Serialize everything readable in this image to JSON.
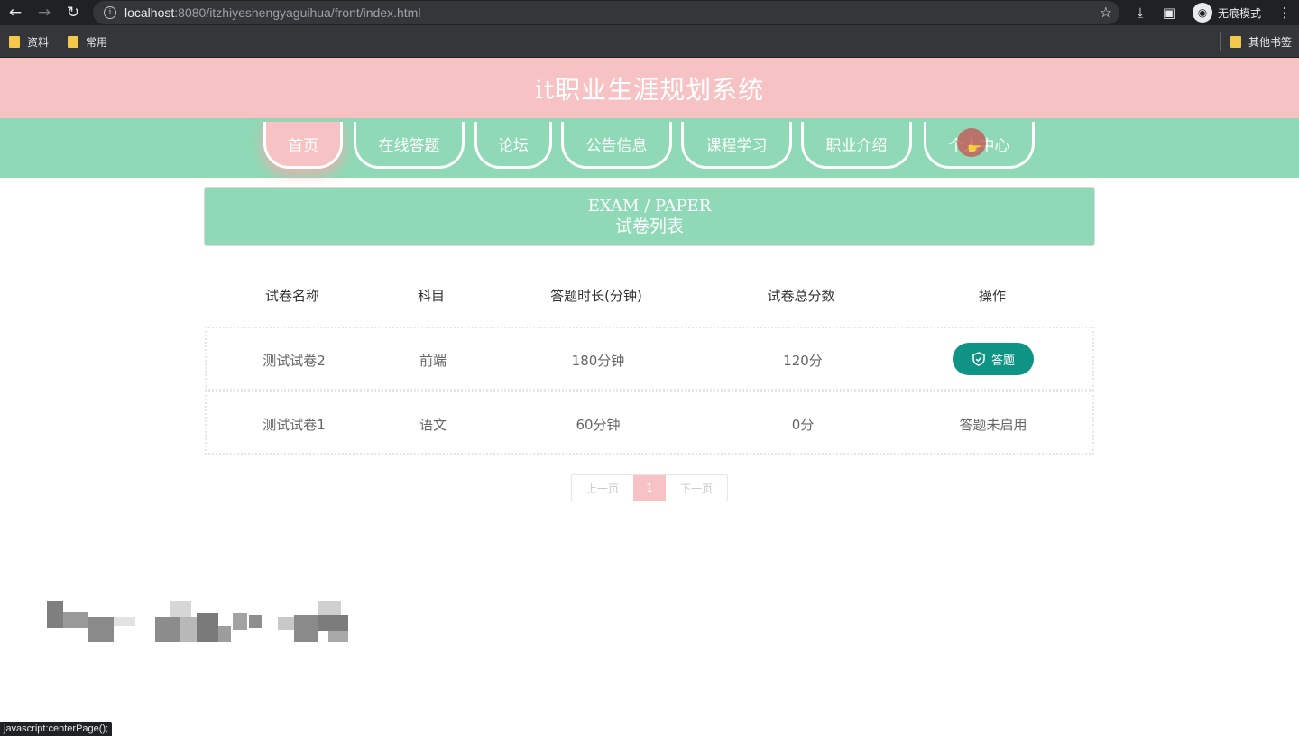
{
  "browser": {
    "url_host": "localhost",
    "url_rest": ":8080/itzhiyeshengyaguihua/front/index.html",
    "incognito_label": "无痕模式",
    "bookmarks": [
      "资料",
      "常用"
    ],
    "other_bookmarks": "其他书签",
    "status_text": "javascript:centerPage();"
  },
  "site": {
    "title": "it职业生涯规划系统",
    "nav": [
      "首页",
      "在线答题",
      "论坛",
      "公告信息",
      "课程学习",
      "职业介绍",
      "个人中心"
    ],
    "active_nav": "首页"
  },
  "section": {
    "title_en": "EXAM / PAPER",
    "title_cn": "试卷列表"
  },
  "table": {
    "headers": [
      "试卷名称",
      "科目",
      "答题时长(分钟)",
      "试卷总分数",
      "操作"
    ],
    "rows": [
      {
        "name": "测试试卷2",
        "subject": "前端",
        "duration": "180分钟",
        "score": "120分",
        "action": "答题",
        "action_type": "button"
      },
      {
        "name": "测试试卷1",
        "subject": "语文",
        "duration": "60分钟",
        "score": "0分",
        "action": "答题未启用",
        "action_type": "text"
      }
    ]
  },
  "pagination": {
    "prev": "上一页",
    "current": "1",
    "next": "下一页"
  },
  "colors": {
    "header_pink": "#f7c2c3",
    "nav_green": "#8fd9b6",
    "button_teal": "#0f9385"
  }
}
